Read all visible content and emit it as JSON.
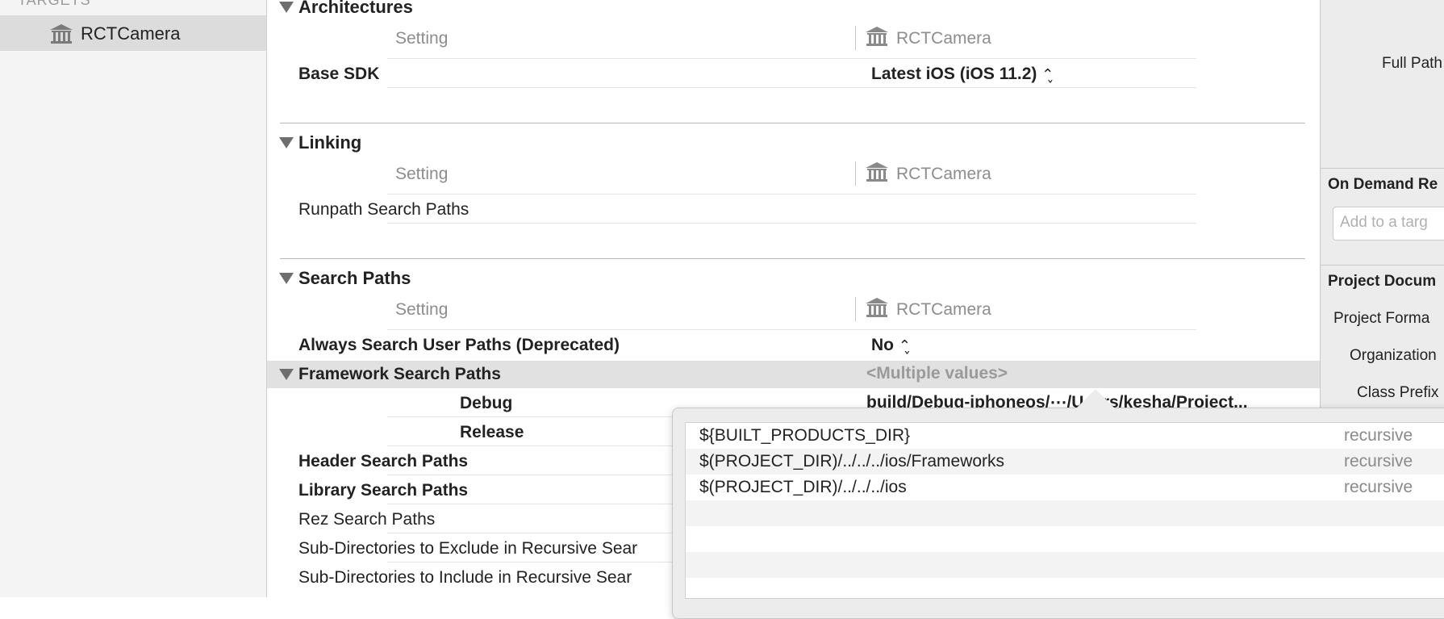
{
  "navigator": {
    "section_header": "TARGETS",
    "target_label": "RCTCamera",
    "target_icon": "building-columns-icon"
  },
  "sections": {
    "architectures": {
      "title": "Architectures",
      "setting_header": "Setting",
      "target_col": "RCTCamera",
      "rows": [
        {
          "label": "Base SDK",
          "value": "Latest iOS (iOS 11.2)"
        }
      ]
    },
    "linking": {
      "title": "Linking",
      "setting_header": "Setting",
      "target_col": "RCTCamera",
      "rows": [
        {
          "label": "Runpath Search Paths",
          "value": ""
        }
      ]
    },
    "search_paths": {
      "title": "Search Paths",
      "setting_header": "Setting",
      "target_col": "RCTCamera",
      "always_search": {
        "label": "Always Search User Paths (Deprecated)",
        "value": "No"
      },
      "framework": {
        "label": "Framework Search Paths",
        "value": "<Multiple values>"
      },
      "debug": {
        "label": "Debug",
        "value": "build/Debug-iphoneos/⋯/Users/kesha/Project..."
      },
      "release": {
        "label": "Release"
      },
      "header": {
        "label": "Header Search Paths"
      },
      "library": {
        "label": "Library Search Paths"
      },
      "rez": {
        "label": "Rez Search Paths"
      },
      "exclude": {
        "label": "Sub-Directories to Exclude in Recursive Sear"
      },
      "include": {
        "label": "Sub-Directories to Include in Recursive Sear"
      }
    }
  },
  "popover": {
    "paths": [
      {
        "path": "${BUILT_PRODUCTS_DIR}",
        "mode": "recursive"
      },
      {
        "path": "$(PROJECT_DIR)/../../../ios/Frameworks",
        "mode": "recursive"
      },
      {
        "path": "$(PROJECT_DIR)/../../../ios",
        "mode": "recursive"
      }
    ]
  },
  "inspector": {
    "full_path": "Full Path",
    "on_demand": "On Demand Re",
    "add_target_placeholder": "Add to a targ",
    "project_document": "Project Docum",
    "project_format": "Project Forma",
    "organization": "Organization",
    "class_prefix": "Class Prefix"
  },
  "colors": {
    "selected_row": "#dcdcdc",
    "highlight_row": "#e1e1e1",
    "muted_text": "#8d8d8d"
  }
}
